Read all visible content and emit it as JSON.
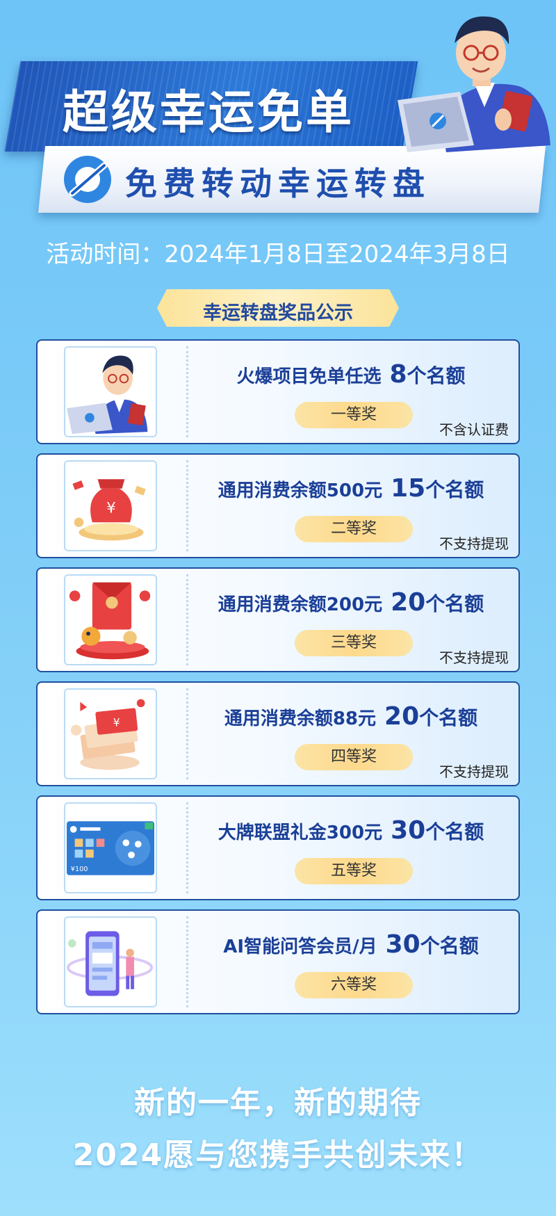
{
  "header": {
    "title": "超级幸运免单",
    "subtitle": "免费转动幸运转盘",
    "date": "活动时间：2024年1月8日至2024年3月8日",
    "prize_tag": "幸运转盘奖品公示"
  },
  "prizes": [
    {
      "name": "火爆项目免单任选",
      "count": "8",
      "unit": "个名额",
      "level": "一等奖",
      "note": "不含认证费",
      "icon": "person-laptop-icon"
    },
    {
      "name": "通用消费余额500元",
      "count": "15",
      "unit": "个名额",
      "level": "二等奖",
      "note": "不支持提现",
      "icon": "money-bag-icon"
    },
    {
      "name": "通用消费余额200元",
      "count": "20",
      "unit": "个名额",
      "level": "三等奖",
      "note": "不支持提现",
      "icon": "red-envelope-icon"
    },
    {
      "name": "通用消费余额88元",
      "count": "20",
      "unit": "个名额",
      "level": "四等奖",
      "note": "不支持提现",
      "icon": "cash-stack-icon"
    },
    {
      "name": "大牌联盟礼金300元",
      "count": "30",
      "unit": "个名额",
      "level": "五等奖",
      "note": "",
      "icon": "gift-card-icon"
    },
    {
      "name": "AI智能问答会员/月",
      "count": "30",
      "unit": "个名额",
      "level": "六等奖",
      "note": "",
      "icon": "smartphone-icon"
    }
  ],
  "card_text": {
    "value": "¥100"
  },
  "footer": {
    "line1": "新的一年，新的期待",
    "line2": "2024愿与您携手共创未来！"
  },
  "colors": {
    "primary": "#1f4fae",
    "accent": "#fbe39a",
    "background": "#7fcdf8"
  }
}
